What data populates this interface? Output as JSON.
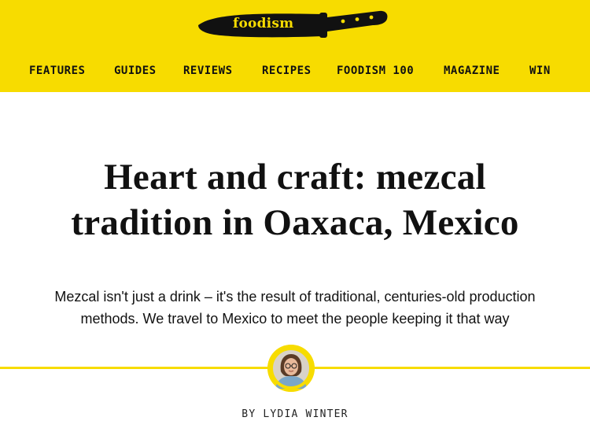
{
  "brand": {
    "logo_text": "foodism",
    "accent_color": "#f7dc00",
    "logo_icon": "knife-icon"
  },
  "nav": {
    "items": [
      {
        "label": "FEATURES"
      },
      {
        "label": "GUIDES"
      },
      {
        "label": "REVIEWS"
      },
      {
        "label": "RECIPES"
      },
      {
        "label": "FOODISM 100"
      },
      {
        "label": "MAGAZINE"
      },
      {
        "label": "WIN"
      }
    ]
  },
  "article": {
    "title_line1": "Heart and craft: mezcal",
    "title_line2": "tradition in Oaxaca, Mexico",
    "standfirst_line1": "Mezcal isn't just a drink – it's the result of traditional, centuries-old production",
    "standfirst_line2": "methods. We travel to Mexico to meet the people keeping it that way",
    "byline": "BY LYDIA WINTER"
  }
}
